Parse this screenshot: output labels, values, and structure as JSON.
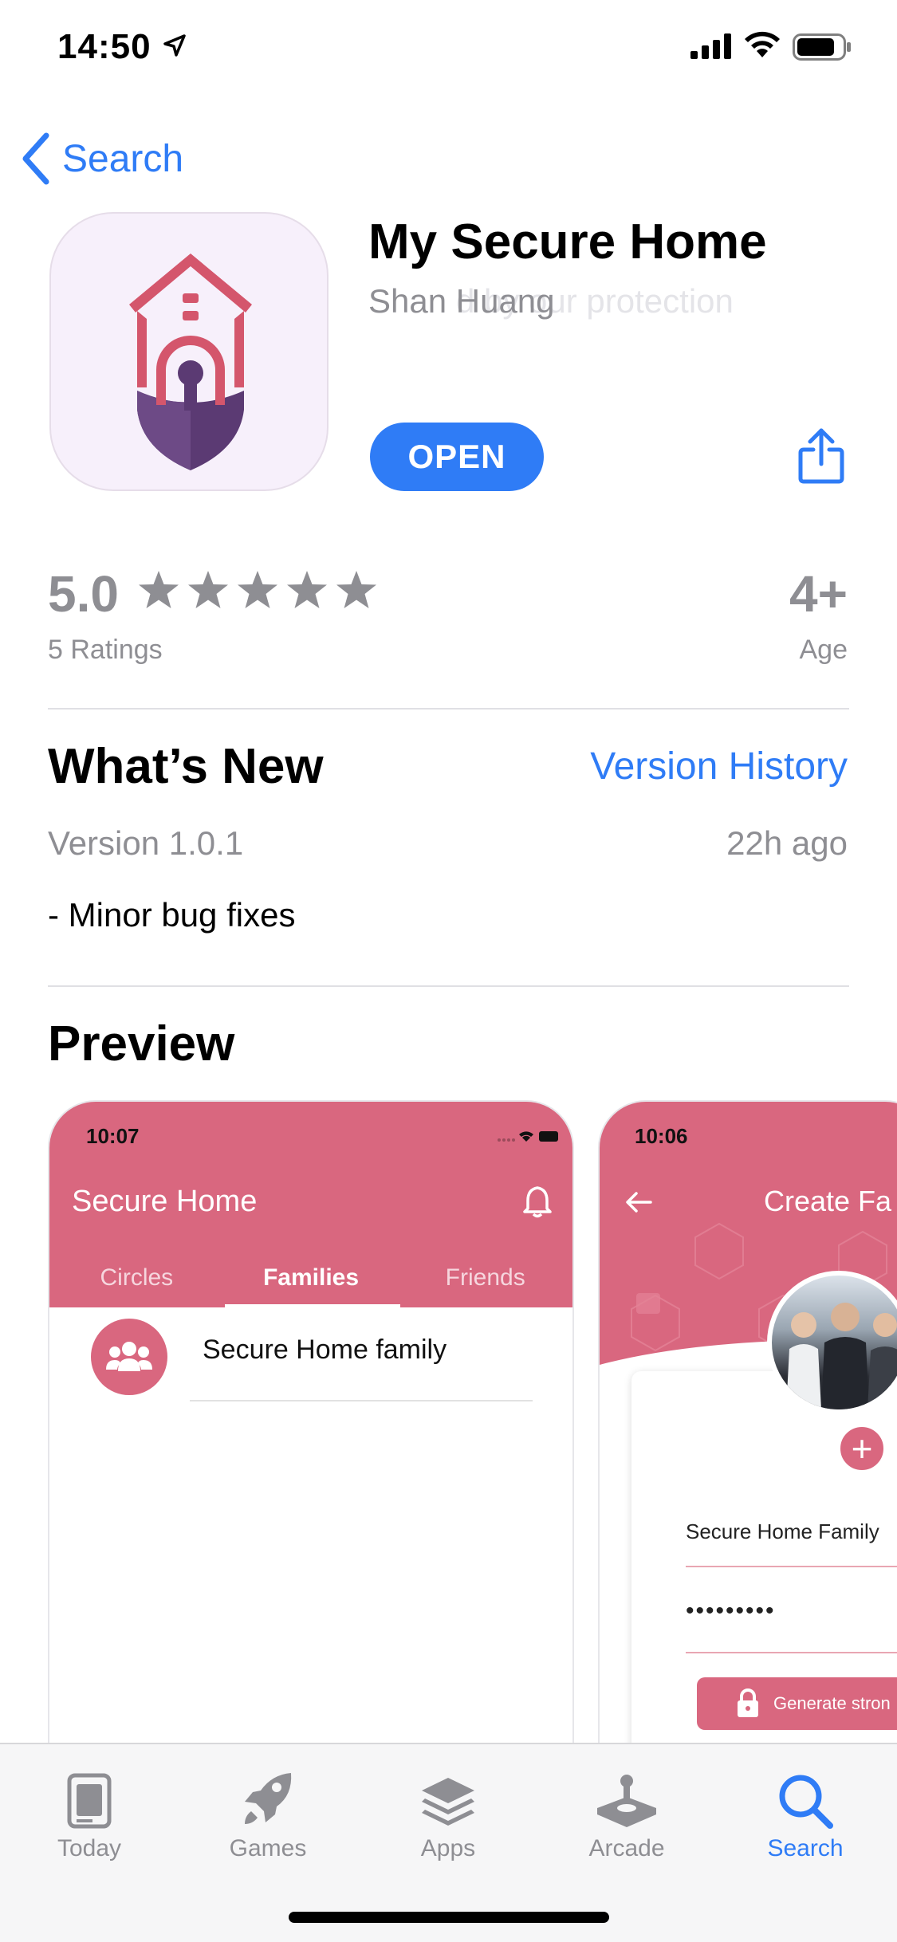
{
  "status_bar": {
    "time": "14:50",
    "icons": [
      "location-arrow-icon",
      "cell-signal-icon",
      "wifi-icon",
      "battery-icon"
    ]
  },
  "nav": {
    "back_label": "Search"
  },
  "app": {
    "title": "My Secure Home",
    "developer": "Shan Huang",
    "subtitle_ghost": "d by our protection",
    "open_label": "OPEN",
    "icon": "secure-home-app-icon"
  },
  "ratings": {
    "value": "5.0",
    "stars": 5,
    "count_label": "5 Ratings",
    "age_value": "4+",
    "age_label": "Age"
  },
  "whats_new": {
    "title": "What’s New",
    "history_link": "Version History",
    "version": "Version 1.0.1",
    "time_ago": "22h ago",
    "notes": "- Minor bug fixes"
  },
  "preview": {
    "title": "Preview",
    "screens": [
      {
        "time": "10:07",
        "title": "Secure Home",
        "tabs": [
          "Circles",
          "Families",
          "Friends"
        ],
        "active_tab": "Families",
        "list_item": "Secure Home family"
      },
      {
        "time": "10:06",
        "title": "Create Fa",
        "field_value": "Secure Home Family",
        "password_mask": "•••••••••",
        "button_label": "Generate stron"
      }
    ]
  },
  "colors": {
    "accent": "#2f7cf6",
    "secondary_text": "#8e8e93",
    "preview_pink": "#d9677f",
    "icon_purple": "#5b3a73",
    "icon_red": "#d4566c"
  },
  "tab_bar": {
    "items": [
      {
        "label": "Today",
        "icon": "today-icon",
        "active": false
      },
      {
        "label": "Games",
        "icon": "rocket-icon",
        "active": false
      },
      {
        "label": "Apps",
        "icon": "layers-icon",
        "active": false
      },
      {
        "label": "Arcade",
        "icon": "joystick-icon",
        "active": false
      },
      {
        "label": "Search",
        "icon": "search-icon",
        "active": true
      }
    ]
  }
}
